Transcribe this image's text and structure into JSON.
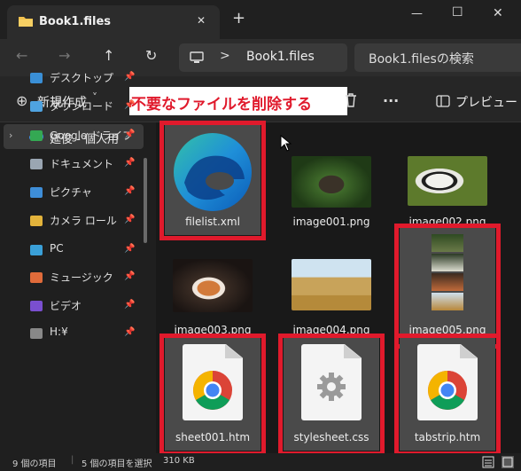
{
  "window": {
    "tab_title": "Book1.files",
    "new_tab": "+",
    "minimize": "—",
    "maximize": "☐",
    "close": "✕",
    "tab_close": "✕"
  },
  "navbar": {
    "back": "←",
    "forward": "→",
    "up": "↑",
    "refresh": "↻",
    "breadcrumb_sep": ">",
    "location": "Book1.files",
    "search_placeholder": "Book1.filesの検索"
  },
  "toolbar": {
    "new_label": "新規作成",
    "new_icon": "⊕",
    "new_chevron": "˅",
    "more": "···",
    "preview_label": "プレビュー",
    "annotation": "不要なファイルを削除する"
  },
  "sidebar": {
    "onedrive_label": "延俊 - 個人用",
    "items": [
      {
        "label": "デスクトップ",
        "color": "#3a8fd6"
      },
      {
        "label": "ダウンロード",
        "color": "#4fa3e0"
      },
      {
        "label": "Google ドライブ",
        "color": "#34a853"
      },
      {
        "label": "ドキュメント",
        "color": "#9aa6b2"
      },
      {
        "label": "ピクチャ",
        "color": "#3e8ed8"
      },
      {
        "label": "カメラ ロール",
        "color": "#e3b33b"
      },
      {
        "label": "PC",
        "color": "#3aa0d8"
      },
      {
        "label": "ミュージック",
        "color": "#e06b3a"
      },
      {
        "label": "ビデオ",
        "color": "#7a4fd0"
      },
      {
        "label": "H:¥",
        "color": "#888888"
      }
    ],
    "pin": "📌"
  },
  "files": [
    {
      "name": "filelist.xml",
      "kind": "edge",
      "selected": true,
      "marked": true
    },
    {
      "name": "image001.png",
      "kind": "chimp",
      "selected": false,
      "marked": false
    },
    {
      "name": "image002.png",
      "kind": "panda",
      "selected": false,
      "marked": false
    },
    {
      "name": "image003.png",
      "kind": "fox",
      "selected": false,
      "marked": false
    },
    {
      "name": "image004.png",
      "kind": "lion",
      "selected": false,
      "marked": false
    },
    {
      "name": "image005.png",
      "kind": "collage",
      "selected": true,
      "marked": true
    },
    {
      "name": "sheet001.htm",
      "kind": "chrome",
      "selected": true,
      "marked": true
    },
    {
      "name": "stylesheet.css",
      "kind": "css",
      "selected": true,
      "marked": true
    },
    {
      "name": "tabstrip.htm",
      "kind": "chrome",
      "selected": true,
      "marked": true
    }
  ],
  "status": {
    "count": "9 個の項目",
    "selection": "5 個の項目を選択",
    "size": "310 KB"
  },
  "colors": {
    "annotation_red": "#e01a2c",
    "selection_bg": "#4a4a4a",
    "window_bg": "#191919"
  }
}
